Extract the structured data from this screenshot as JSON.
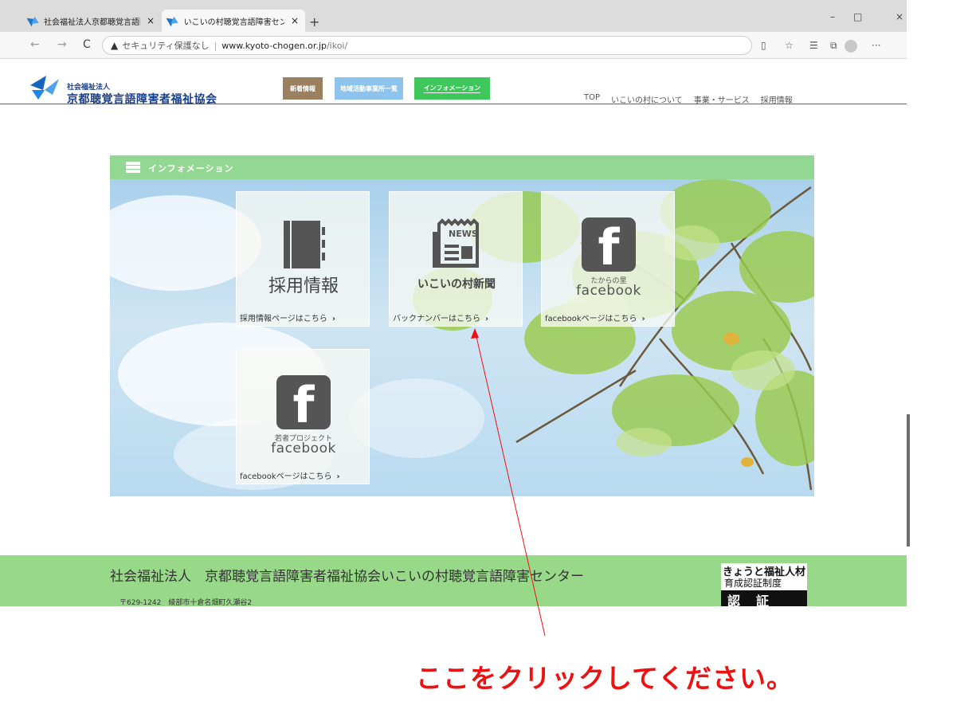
{
  "browser": {
    "tabs": [
      {
        "title": "社会福祉法人京都聴覚言語障害",
        "close": "×"
      },
      {
        "title": "いこいの村聴覚言語障害センター",
        "close": "×"
      }
    ],
    "new_tab": "+",
    "window_controls": {
      "minimize": "–",
      "maximize": "□",
      "close": "×"
    },
    "nav": {
      "back": "←",
      "forward": "→",
      "reload": "C"
    },
    "address": {
      "warning_icon": "▲",
      "security_text": "セキュリティ保護なし",
      "separator": "|",
      "domain": "www.kyoto-chogen.or.jp",
      "path": "/ikoi/"
    },
    "toolbar_icons": [
      "reader-icon",
      "favorite-add-icon",
      "favorites-icon",
      "collections-icon",
      "profile-icon",
      "more-icon"
    ],
    "more": "···"
  },
  "site": {
    "logo_small": "社会福祉法人",
    "logo_big": "京都聴覚言語障害者福祉協会",
    "header_buttons": [
      "新着情報",
      "地域活動事業所一覧",
      "インフォメーション"
    ],
    "topnav": [
      "TOP",
      "いこいの村について",
      "事業・サービス",
      "採用情報"
    ]
  },
  "info": {
    "title": "インフォメーション",
    "cards": [
      {
        "caption": "採用情報",
        "link": "採用情報ページはこちら",
        "chev": "›"
      },
      {
        "badge": "NEWS",
        "caption": "いこいの村新聞",
        "link": "バックナンバーはこちら",
        "chev": "›"
      },
      {
        "sub": "たからの里",
        "caption": "facebook",
        "link": "facebookページはこちら",
        "chev": "›"
      },
      {
        "sub": "若者プロジェクト",
        "caption": "facebook",
        "link": "facebookページはこちら",
        "chev": "›"
      }
    ]
  },
  "footer": {
    "title": "社会福祉法人　京都聴覚言語障害者福祉協会いこいの村聴覚言語障害センター",
    "address": "〒629-1242　綾部市十倉名畑町久瀬谷2",
    "badge_line1": "きょうと福祉人材",
    "badge_line2": "育成認証制度",
    "badge_line3": "認証"
  },
  "annotation": {
    "text": "ここをクリックしてください。",
    "color": "#ee1111"
  }
}
